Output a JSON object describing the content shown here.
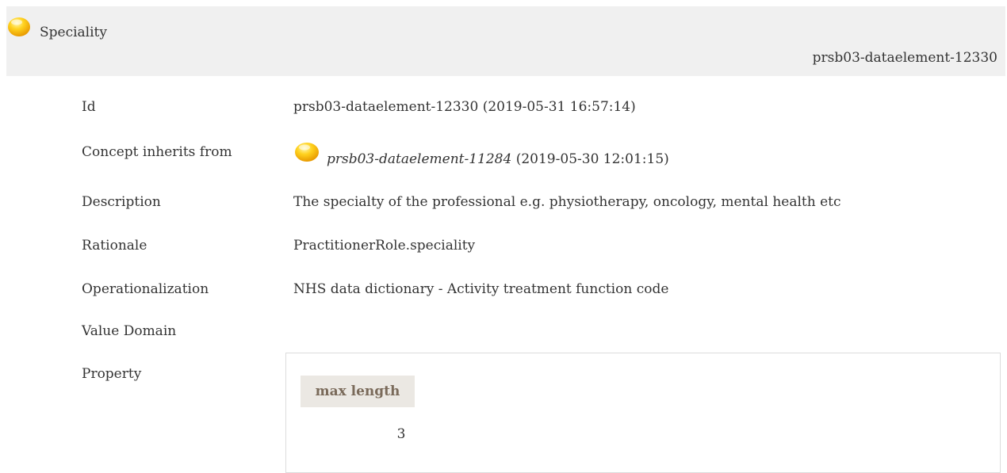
{
  "header": {
    "title": "Speciality",
    "id": "prsb03-dataelement-12330",
    "status_icon": "status-draft-circle-icon",
    "status_color": "#f5b800"
  },
  "details": {
    "id_label": "Id",
    "id_value": "prsb03-dataelement-12330 (2019-05-31 16:57:14)",
    "inherit_label": "Concept inherits from",
    "inherit_ref": "prsb03-dataelement-11284",
    "inherit_date": " (2019-05-30 12:01:15)",
    "inherit_icon": "status-draft-circle-icon",
    "description_label": "Description",
    "description_value": "The specialty of the professional e.g. physiotherapy, oncology, mental health etc",
    "rationale_label": "Rationale",
    "rationale_value": "PractitionerRole.speciality",
    "operationalization_label": "Operationalization",
    "operationalization_value": "NHS data dictionary - Activity treatment function code",
    "value_domain_label": "Value Domain",
    "property_label": "Property"
  },
  "property_table": {
    "column_header": "max length",
    "value": "3"
  }
}
